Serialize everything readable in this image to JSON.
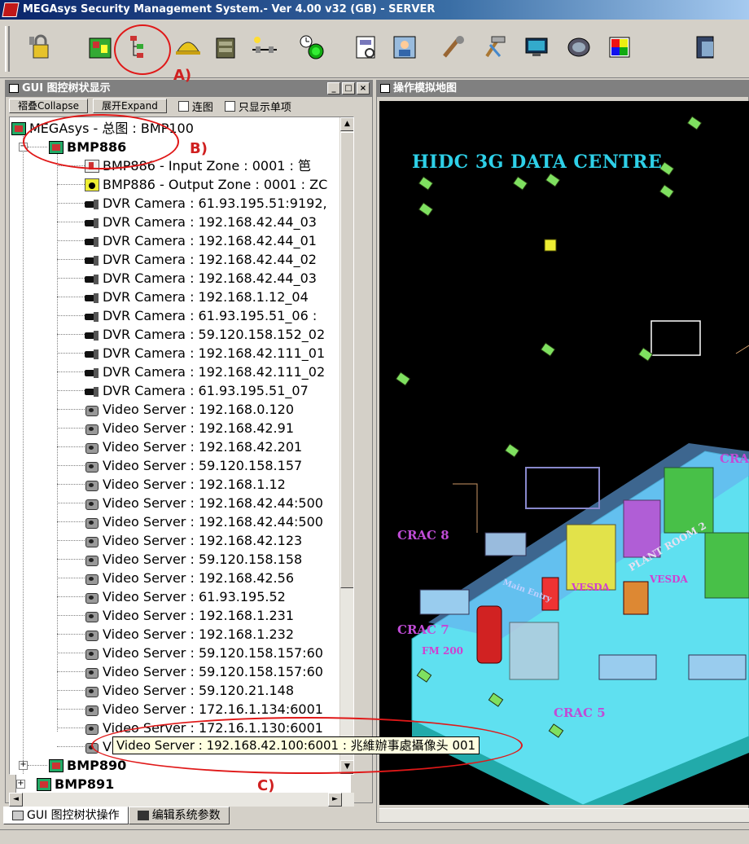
{
  "window": {
    "title": "MEGAsys Security Management System.- Ver 4.00 v32  (GB)  - SERVER"
  },
  "toolbar": {
    "icons": [
      "security-lock-icon",
      "floor-map-icon",
      "tree-view-icon",
      "engineer-helmet-icon",
      "cabinet-icon",
      "network-icon",
      "clock-green-icon",
      "report-icon",
      "user-config-icon",
      "tools-icon",
      "hammer-tools-icon",
      "monitor-icon",
      "camera-icon",
      "grid-color-icon",
      "exit-icon"
    ]
  },
  "left_pane": {
    "title": "GUI 图控树状显示",
    "collapse_label": "褶叠Collapse",
    "expand_label": "展开Expand",
    "check_link": "连图",
    "check_single": "只显示单项"
  },
  "tree": {
    "root": "MEGAsys - 总图 : BMP100",
    "bmp886": "BMP886",
    "children": [
      {
        "type": "in",
        "label": "BMP886 - Input Zone : 0001 :  笆"
      },
      {
        "type": "out",
        "label": "BMP886 - Output Zone : 0001 : ZC"
      },
      {
        "type": "cam",
        "label": "DVR Camera : 61.93.195.51:9192,"
      },
      {
        "type": "cam",
        "label": "DVR Camera : 192.168.42.44_03"
      },
      {
        "type": "cam",
        "label": "DVR Camera : 192.168.42.44_01"
      },
      {
        "type": "cam",
        "label": "DVR Camera : 192.168.42.44_02"
      },
      {
        "type": "cam",
        "label": "DVR Camera : 192.168.42.44_03"
      },
      {
        "type": "cam",
        "label": "DVR Camera : 192.168.1.12_04"
      },
      {
        "type": "cam",
        "label": "DVR Camera : 61.93.195.51_06 :"
      },
      {
        "type": "cam",
        "label": "DVR Camera : 59.120.158.152_02"
      },
      {
        "type": "cam",
        "label": "DVR Camera : 192.168.42.111_01"
      },
      {
        "type": "cam",
        "label": "DVR Camera : 192.168.42.111_02"
      },
      {
        "type": "cam",
        "label": "DVR Camera : 61.93.195.51_07"
      },
      {
        "type": "vs",
        "label": "Video Server : 192.168.0.120"
      },
      {
        "type": "vs",
        "label": "Video Server : 192.168.42.91"
      },
      {
        "type": "vs",
        "label": "Video Server : 192.168.42.201"
      },
      {
        "type": "vs",
        "label": "Video Server : 59.120.158.157"
      },
      {
        "type": "vs",
        "label": "Video Server : 192.168.1.12"
      },
      {
        "type": "vs",
        "label": "Video Server : 192.168.42.44:500"
      },
      {
        "type": "vs",
        "label": "Video Server : 192.168.42.44:500"
      },
      {
        "type": "vs",
        "label": "Video Server : 192.168.42.123"
      },
      {
        "type": "vs",
        "label": "Video Server : 59.120.158.158"
      },
      {
        "type": "vs",
        "label": "Video Server : 192.168.42.56"
      },
      {
        "type": "vs",
        "label": "Video Server : 61.93.195.52"
      },
      {
        "type": "vs",
        "label": "Video Server : 192.168.1.231"
      },
      {
        "type": "vs",
        "label": "Video Server : 192.168.1.232"
      },
      {
        "type": "vs",
        "label": "Video Server : 59.120.158.157:60"
      },
      {
        "type": "vs",
        "label": "Video Server : 59.120.158.157:60"
      },
      {
        "type": "vs",
        "label": "Video Server : 59.120.21.148"
      },
      {
        "type": "vs",
        "label": "Video Server : 172.16.1.134:6001"
      },
      {
        "type": "vs",
        "label": "Video Server : 172.16.1.130:6001"
      },
      {
        "type": "vs",
        "label": "Video Server : 192.168.42.100:6001"
      }
    ],
    "bmp890": "BMP890",
    "bmp891": "BMP891"
  },
  "tooltip": "Video Server : 192.168.42.100:6001 : 兆維辦事處攝像头 001",
  "tabs": {
    "tree_ops": "GUI 图控树状操作",
    "edit_params": "编辑系统参数"
  },
  "map_pane": {
    "title": "操作模拟地图",
    "heading": "HIDC 3G DATA CENTRE",
    "labels": {
      "crac8": "CRAC 8",
      "crac7": "CRAC 7",
      "crac5": "CRAC 5",
      "cra": "CRA",
      "fm200": "FM 200",
      "vesda1": "VESDA",
      "vesda2": "VESDA",
      "plant_room": "PLANT ROOM 2",
      "main_entry": "Main Entry"
    }
  },
  "annotations": {
    "a": "A)",
    "b": "B)",
    "c": "C)"
  }
}
